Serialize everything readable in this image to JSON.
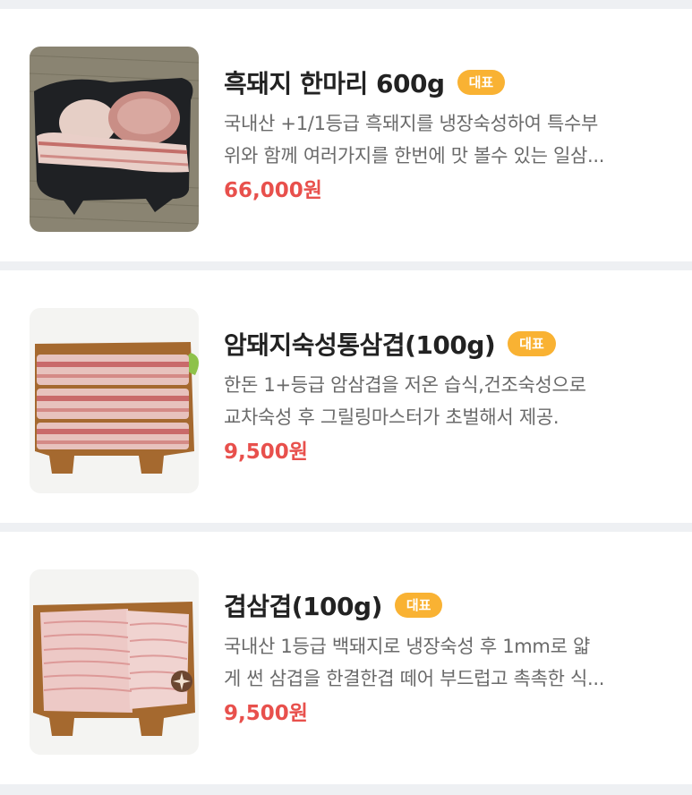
{
  "colors": {
    "badge": "#f9b233",
    "price": "#e8504c",
    "title": "#222222",
    "description": "#6a6a6a",
    "background": "#eef0f3"
  },
  "products": [
    {
      "image_icon": "pork-whole-cuts-image",
      "title": "흑돼지 한마리 600g",
      "badge": "대표",
      "description_lines": [
        "국내산 +1/1등급 흑돼지를 냉장숙성하여 특수부",
        "위와 함께 여러가지를 한번에 맛 볼수 있는 일삼..."
      ],
      "price": "66,000원"
    },
    {
      "image_icon": "pork-belly-slabs-image",
      "title": "암돼지숙성통삼겹(100g)",
      "badge": "대표",
      "description_lines": [
        "한돈 1+등급 암삼겹을 저온 습식,건조숙성으로",
        "교차숙성 후 그릴링마스터가 초벌해서 제공."
      ],
      "price": "9,500원"
    },
    {
      "image_icon": "thin-sliced-pork-belly-image",
      "title": "겹삼겹(100g)",
      "badge": "대표",
      "description_lines": [
        "국내산 1등급 백돼지로 냉장숙성 후 1mm로 얇",
        "게 썬 삼겹을 한결한겹 떼어 부드럽고 촉촉한 식..."
      ],
      "price": "9,500원"
    }
  ]
}
